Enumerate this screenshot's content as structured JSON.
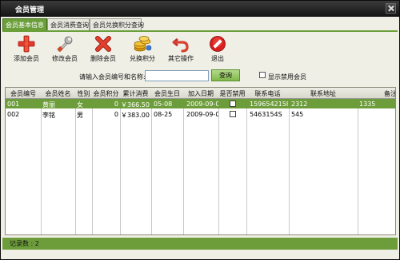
{
  "window": {
    "title": "会员管理"
  },
  "tabs": [
    "会员基本信息",
    "会员消费查询",
    "会员兑换积分查询"
  ],
  "toolbar": {
    "items": [
      {
        "label": "添加会员",
        "icon": "plus-icon"
      },
      {
        "label": "修改会员",
        "icon": "wrench-icon"
      },
      {
        "label": "删除会员",
        "icon": "delete-x-icon"
      },
      {
        "label": "兑换积分",
        "icon": "coins-icon"
      },
      {
        "label": "其它操作",
        "icon": "undo-arrow-icon"
      },
      {
        "label": "退出",
        "icon": "stop-icon"
      }
    ],
    "colors": {
      "plus": "#e23a2a",
      "delete": "#d63b2b",
      "stop": "#d81e1e",
      "coin": "#e8b21b"
    }
  },
  "search": {
    "label": "请输入会员编号和名称:",
    "value": "",
    "button": "查询",
    "checkbox_label": "显示禁用会员",
    "checkbox_checked": false
  },
  "table": {
    "columns": [
      "会员编号",
      "会员姓名",
      "性别",
      "会员积分",
      "累计消费",
      "会员生日",
      "加入日期",
      "是否禁用",
      "联系电话",
      "联系地址",
      "备注"
    ],
    "rows": [
      {
        "id": "001",
        "name": "黄丽",
        "gender": "女",
        "points": "0",
        "total": "￥366.50",
        "birthday": "05-08",
        "join": "2009-09-04",
        "disabled": false,
        "phone": "15965421587",
        "address": "2312",
        "note": "1335"
      },
      {
        "id": "002",
        "name": "李铭",
        "gender": "男",
        "points": "0",
        "total": "￥383.00",
        "birthday": "08-25",
        "join": "2009-09-04",
        "disabled": false,
        "phone": "5463154S",
        "address": "545",
        "note": ""
      }
    ],
    "selected_row": 0,
    "colors": {
      "header": "#dcdcd0",
      "selected": "#6d9d3a"
    }
  },
  "status": {
    "record_count_label": "记录数 : 2"
  }
}
